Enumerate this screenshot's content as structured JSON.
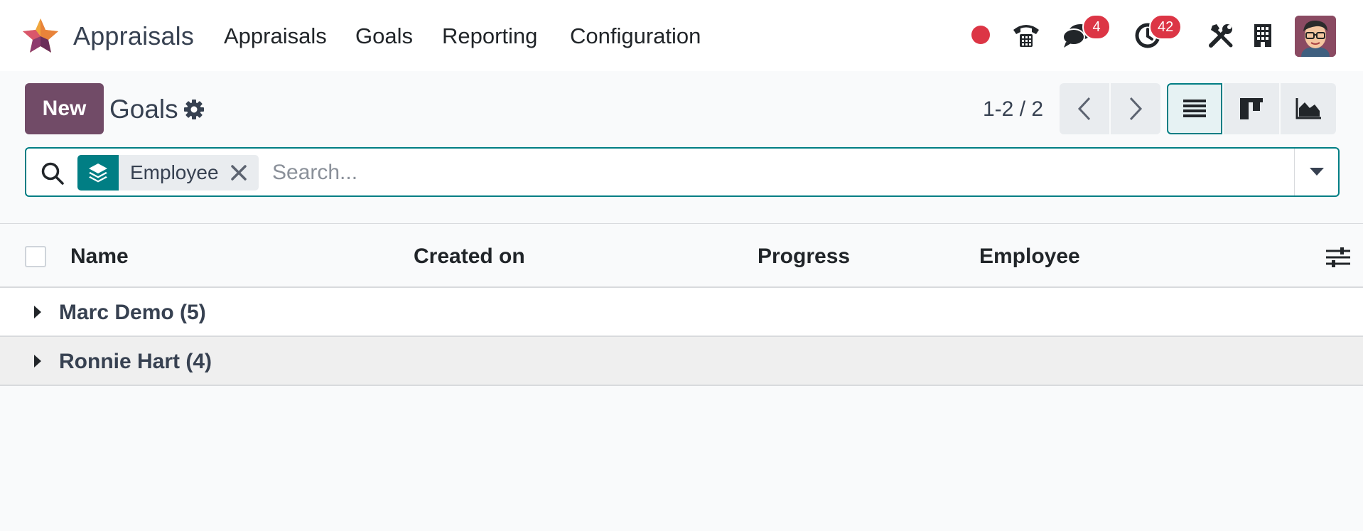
{
  "navbar": {
    "app_name": "Appraisals",
    "menu": [
      "Appraisals",
      "Goals",
      "Reporting",
      "Configuration"
    ],
    "status_color": "#dc3545",
    "messages_badge": "4",
    "activities_badge": "42",
    "icons": [
      "status-dot-icon",
      "phone-icon",
      "chat-icon",
      "clock-icon",
      "tools-icon",
      "building-icon"
    ]
  },
  "control_panel": {
    "new_label": "New",
    "title": "Goals",
    "pager": "1-2 / 2",
    "views": [
      "list",
      "kanban",
      "graph"
    ],
    "active_view": "list"
  },
  "search": {
    "facet_label": "Employee",
    "facet_icon": "layers-icon",
    "placeholder": "Search..."
  },
  "list": {
    "columns": [
      "Name",
      "Created on",
      "Progress",
      "Employee"
    ],
    "groups": [
      {
        "label": "Marc Demo (5)"
      },
      {
        "label": "Ronnie Hart (4)"
      }
    ]
  },
  "colors": {
    "brand": "#714b67",
    "accent": "#017e84",
    "badge": "#dc3545"
  }
}
